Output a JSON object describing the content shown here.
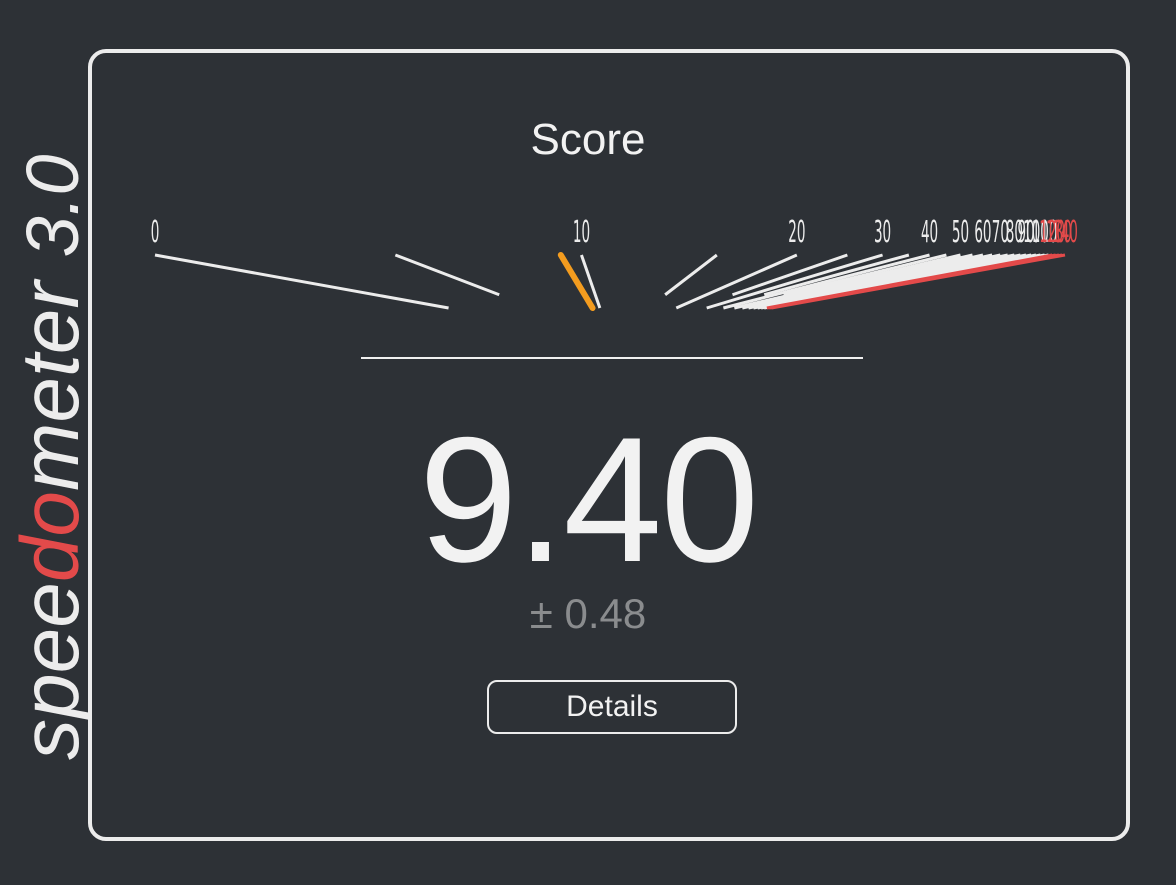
{
  "logo": {
    "part1": "spee",
    "part2": "do",
    "part3": "meter",
    "version": "3.0",
    "accent_color": "#e34a4a",
    "text_color": "#ececec"
  },
  "score": {
    "title": "Score",
    "value": "9.40",
    "error": "± 0.48"
  },
  "gauge": {
    "min": 0,
    "max": 140,
    "current_value": 9.4,
    "tick_labels": [
      "0",
      "10",
      "20",
      "30",
      "40",
      "50",
      "60",
      "70",
      "80",
      "90",
      "100",
      "110",
      "120",
      "130",
      "140"
    ],
    "red_from": 120,
    "colors": {
      "normal": "#ececec",
      "red": "#e34a4a",
      "needle": "#f39c1f"
    }
  },
  "details_button": {
    "label": "Details"
  }
}
